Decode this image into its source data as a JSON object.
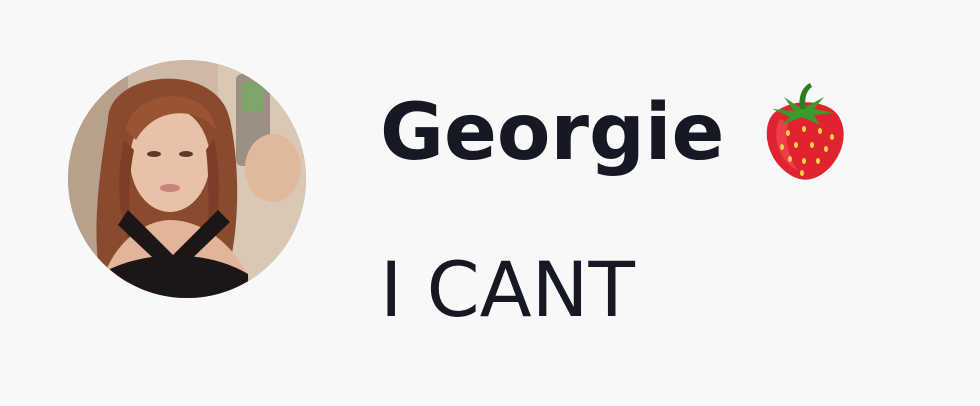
{
  "comment": {
    "username": "Georgie",
    "username_emoji": "strawberry-icon",
    "text": "I CANT"
  },
  "colors": {
    "background": "#f8f8f8",
    "text": "#161823"
  }
}
